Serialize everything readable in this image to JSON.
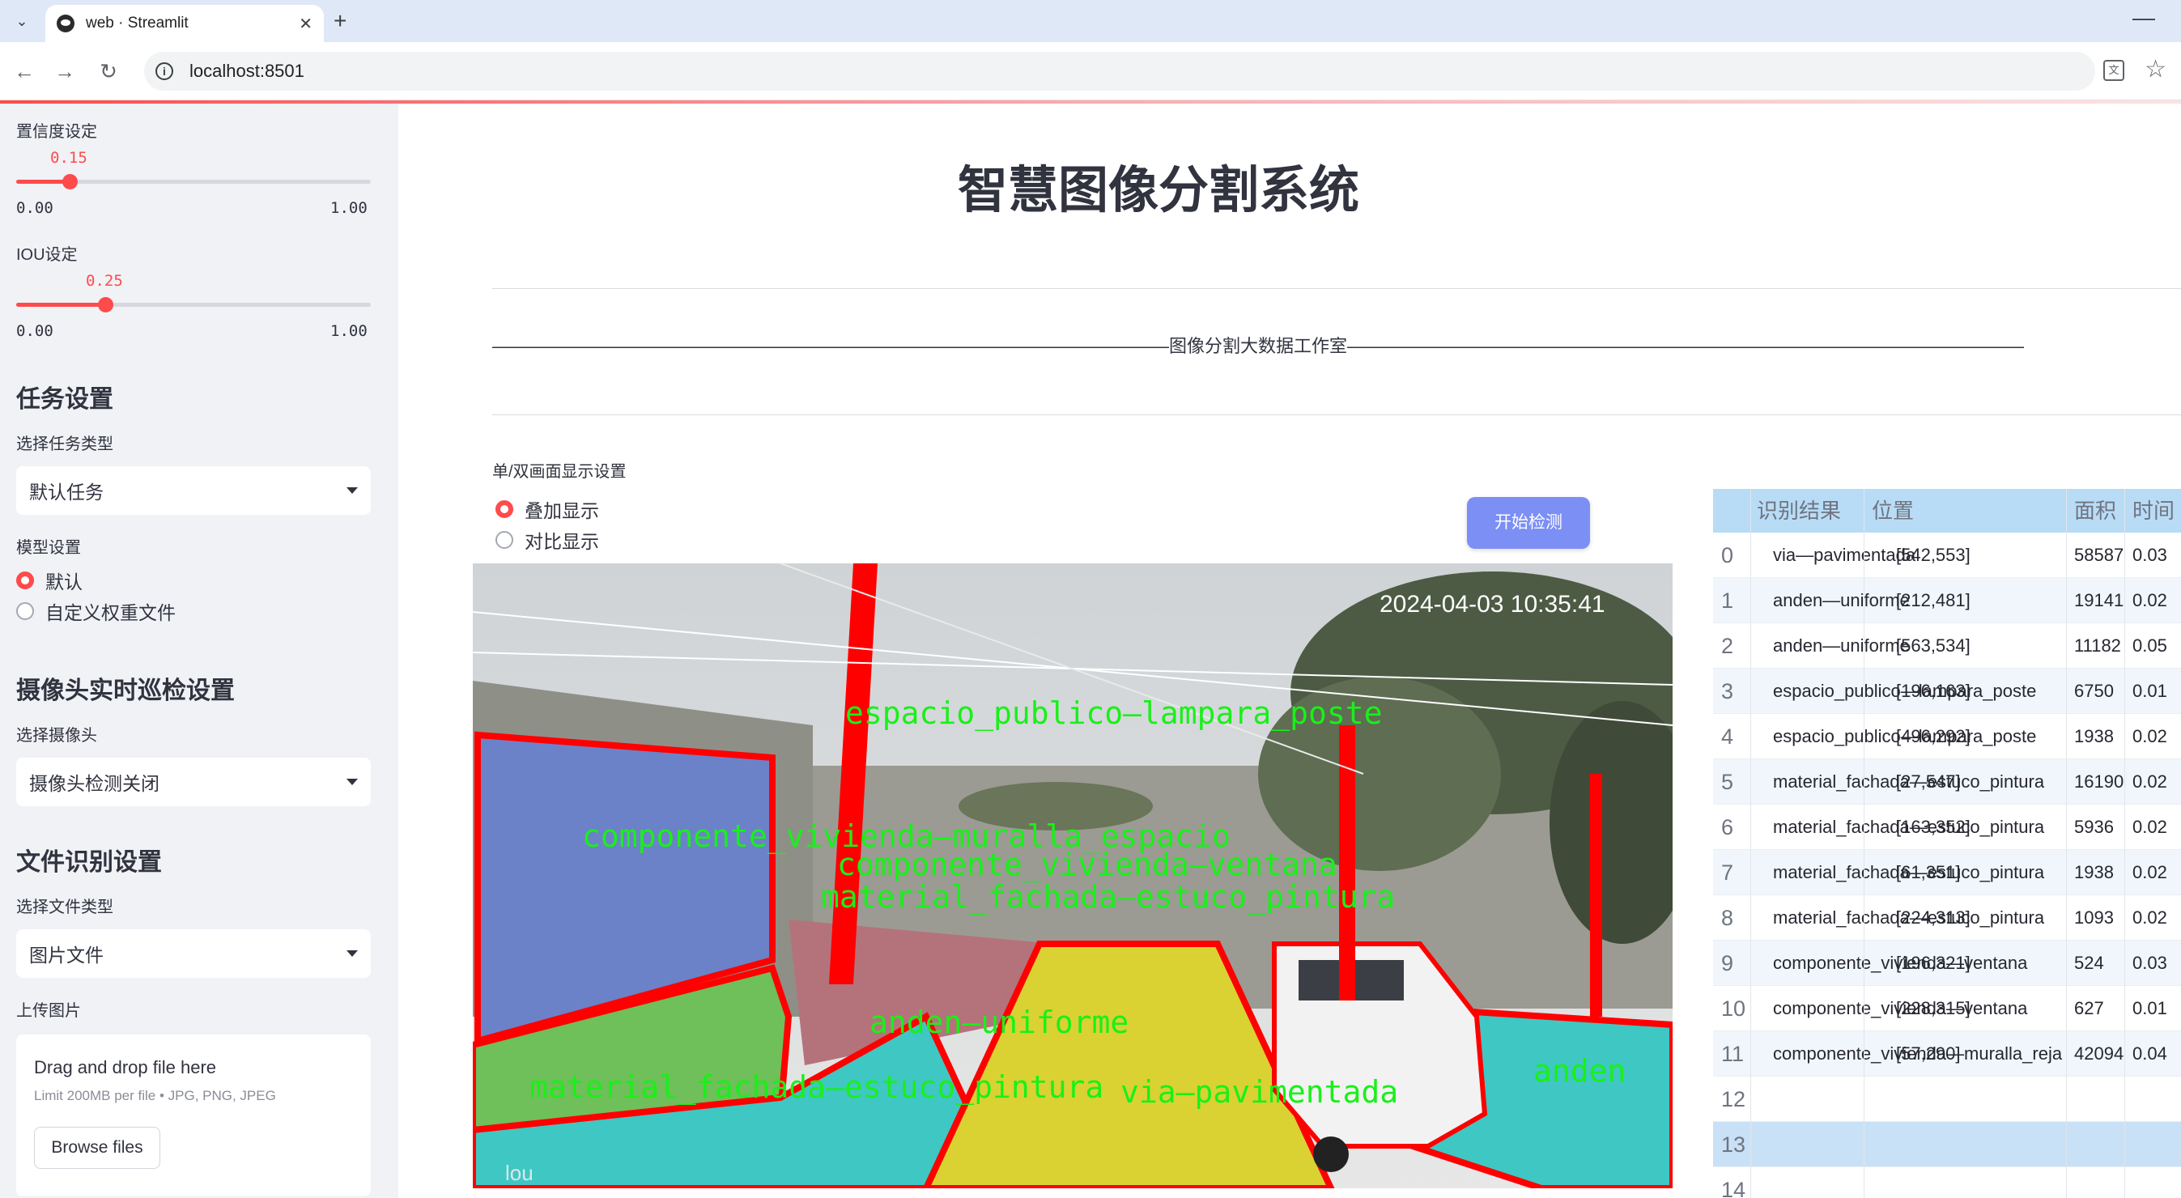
{
  "browser": {
    "tab_title": "web · Streamlit",
    "url": "localhost:8501"
  },
  "sidebar": {
    "confidence": {
      "label": "置信度设定",
      "value": "0.15",
      "min": "0.00",
      "max": "1.00",
      "fraction": 0.15
    },
    "iou": {
      "label": "IOU设定",
      "value": "0.25",
      "min": "0.00",
      "max": "1.00",
      "fraction": 0.25
    },
    "task_heading": "任务设置",
    "task_type_label": "选择任务类型",
    "task_type_value": "默认任务",
    "model_label": "模型设置",
    "model_options": [
      "默认",
      "自定义权重文件"
    ],
    "model_selected": 0,
    "camera_heading": "摄像头实时巡检设置",
    "camera_label": "选择摄像头",
    "camera_value": "摄像头检测关闭",
    "file_heading": "文件识别设置",
    "file_type_label": "选择文件类型",
    "file_type_value": "图片文件",
    "upload_label": "上传图片",
    "upload_title": "Drag and drop file here",
    "upload_sub": "Limit 200MB per file • JPG, PNG, JPEG",
    "browse_label": "Browse files"
  },
  "main": {
    "title": "智慧图像分割系统",
    "dash_line": "——————————————————————————————————————图像分割大数据工作室——————————————————————————————————————",
    "display_label": "单/双画面显示设置",
    "display_options": [
      "叠加显示",
      "对比显示"
    ],
    "display_selected": 0,
    "start_button": "开始检测"
  },
  "image": {
    "timestamp": "2024-04-03 10:35:41",
    "watermark": "lou",
    "overlay_labels": [
      "espacio_publico—lampara_poste",
      "componente_vivienda—muralla_espacio",
      "componente_vivienda—ventana",
      "material_fachada—estuco_pintura",
      "anden—uniforme",
      "material_fachada—estuco_pintura",
      "via—pavimentada",
      "anden"
    ],
    "colors": {
      "road": "#d9d232",
      "sidewalk": "#3fc7c3",
      "facade_green": "#6fbf5a",
      "wall_blue": "#6b82c8",
      "outline": "#ff0000",
      "label": "#19f019"
    }
  },
  "table": {
    "headers": [
      "识别结果",
      "位置",
      "面积",
      "时间"
    ],
    "rows": [
      {
        "idx": "0",
        "result": "via—pavimentada",
        "pos": "[542,553]",
        "area": "58587",
        "time": "0.03"
      },
      {
        "idx": "1",
        "result": "anden—uniforme",
        "pos": "[212,481]",
        "area": "19141",
        "time": "0.02"
      },
      {
        "idx": "2",
        "result": "anden—uniforme",
        "pos": "[563,534]",
        "area": "11182",
        "time": "0.05"
      },
      {
        "idx": "3",
        "result": "espacio_publico—lampara_poste",
        "pos": "[196,163]",
        "area": "6750",
        "time": "0.01"
      },
      {
        "idx": "4",
        "result": "espacio_publico—lampara_poste",
        "pos": "[496,292]",
        "area": "1938",
        "time": "0.02"
      },
      {
        "idx": "5",
        "result": "material_fachada—estuco_pintura",
        "pos": "[27,547]",
        "area": "16190",
        "time": "0.02"
      },
      {
        "idx": "6",
        "result": "material_fachada—estuco_pintura",
        "pos": "[163,352]",
        "area": "5936",
        "time": "0.02"
      },
      {
        "idx": "7",
        "result": "material_fachada—estuco_pintura",
        "pos": "[61,351]",
        "area": "1938",
        "time": "0.02"
      },
      {
        "idx": "8",
        "result": "material_fachada—estuco_pintura",
        "pos": "[224,313]",
        "area": "1093",
        "time": "0.02"
      },
      {
        "idx": "9",
        "result": "componente_vivienda—ventana",
        "pos": "[196,321]",
        "area": "524",
        "time": "0.03"
      },
      {
        "idx": "10",
        "result": "componente_vivienda—ventana",
        "pos": "[228,315]",
        "area": "627",
        "time": "0.01"
      },
      {
        "idx": "11",
        "result": "componente_vivienda—muralla_reja",
        "pos": "[57,290]",
        "area": "42094",
        "time": "0.04"
      },
      {
        "idx": "12",
        "result": "",
        "pos": "",
        "area": "",
        "time": ""
      },
      {
        "idx": "13",
        "result": "",
        "pos": "",
        "area": "",
        "time": ""
      },
      {
        "idx": "14",
        "result": "",
        "pos": "",
        "area": "",
        "time": ""
      }
    ]
  }
}
